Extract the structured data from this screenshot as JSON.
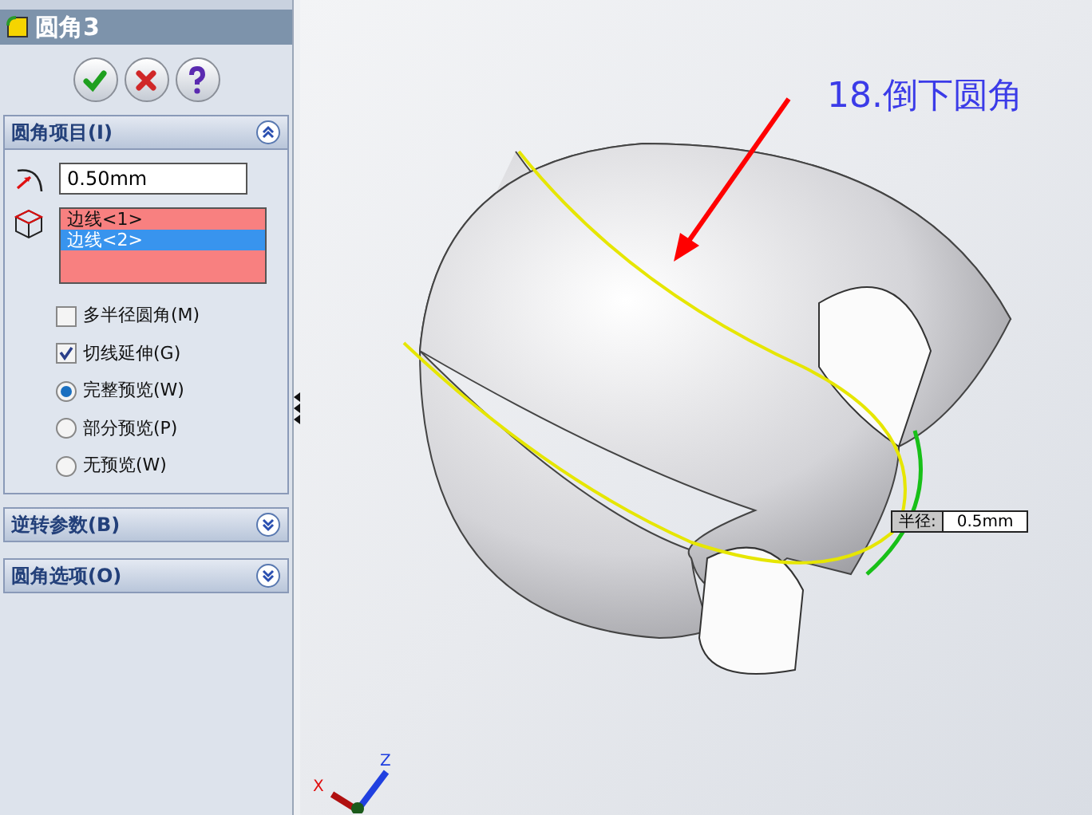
{
  "panel": {
    "title": "圆角3",
    "fillet_items": {
      "title": "圆角项目(I)",
      "expanded": true,
      "radius": "0.50mm",
      "edges": [
        {
          "label": "边线<1>",
          "selected": false
        },
        {
          "label": "边线<2>",
          "selected": true
        }
      ],
      "options": [
        {
          "kind": "checkbox",
          "label": "多半径圆角(M)",
          "checked": false
        },
        {
          "kind": "checkbox",
          "label": "切线延伸(G)",
          "checked": true
        },
        {
          "kind": "radio",
          "label": "完整预览(W)",
          "selected": true
        },
        {
          "kind": "radio",
          "label": "部分预览(P)",
          "selected": false
        },
        {
          "kind": "radio",
          "label": "无预览(W)",
          "selected": false
        }
      ]
    },
    "sections": [
      {
        "title": "逆转参数(B)",
        "expanded": false
      },
      {
        "title": "圆角选项(O)",
        "expanded": false
      }
    ]
  },
  "viewport": {
    "annotation": "18.倒下圆角",
    "dimension_label": "半径:",
    "dimension_value": "0.5mm",
    "axes": [
      "X",
      "Z"
    ]
  }
}
